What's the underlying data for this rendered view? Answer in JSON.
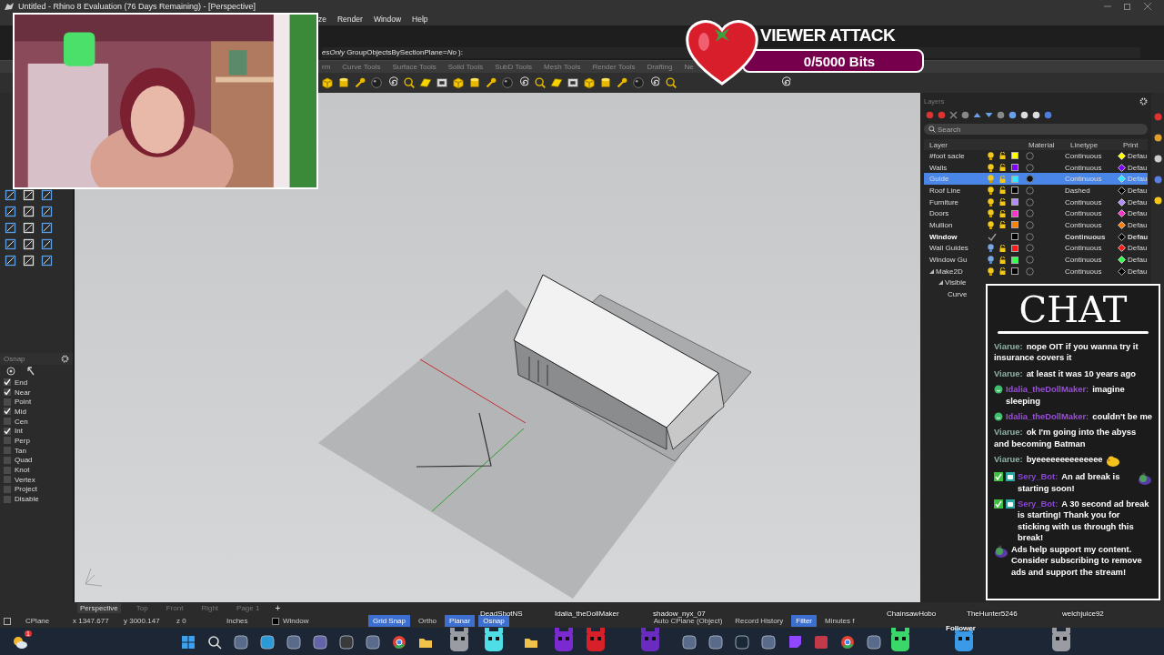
{
  "window": {
    "title": "Untitled - Rhino 8 Evaluation (76 Days Remaining) - [Perspective]"
  },
  "menu": [
    "ze",
    "Render",
    "Window",
    "Help"
  ],
  "command_line": {
    "text": "*esOnly*  GroupObjectsBySectionPlane=*No* ):"
  },
  "toolbar_tabs": [
    "rm",
    "Curve Tools",
    "Surface Tools",
    "Solid Tools",
    "SubD Tools",
    "Mesh Tools",
    "Render Tools",
    "Drafting",
    "Ne"
  ],
  "osnap": {
    "title": "Osnap",
    "items": [
      {
        "label": "End",
        "checked": true
      },
      {
        "label": "Near",
        "checked": true
      },
      {
        "label": "Point",
        "checked": false
      },
      {
        "label": "Mid",
        "checked": true
      },
      {
        "label": "Cen",
        "checked": false
      },
      {
        "label": "Int",
        "checked": true
      },
      {
        "label": "Perp",
        "checked": false
      },
      {
        "label": "Tan",
        "checked": false
      },
      {
        "label": "Quad",
        "checked": false
      },
      {
        "label": "Knot",
        "checked": false
      },
      {
        "label": "Vertex",
        "checked": false
      },
      {
        "label": "Project",
        "checked": false
      },
      {
        "label": "Disable",
        "checked": false
      }
    ]
  },
  "layers": {
    "title": "Layers",
    "search": {
      "placeholder": "Search"
    },
    "columns": [
      "Layer",
      "Material",
      "Linetype",
      "Print"
    ],
    "rows": [
      {
        "name": "#foot sacle",
        "color": "#ffff00",
        "visible": true,
        "material": false,
        "linetype": "Continuous",
        "print": "Defau",
        "current": false,
        "selected": false
      },
      {
        "name": "Walls",
        "color": "#8000ff",
        "visible": true,
        "material": false,
        "linetype": "Continuous",
        "print": "Defau",
        "current": false,
        "selected": false
      },
      {
        "name": "Guide",
        "color": "#33e6ff",
        "visible": true,
        "material": true,
        "linetype": "Continuous",
        "print": "Defau",
        "current": false,
        "selected": true
      },
      {
        "name": "Roof Line",
        "color": "#000000",
        "visible": true,
        "material": false,
        "linetype": "Dashed",
        "print": "Defau",
        "current": false,
        "selected": false
      },
      {
        "name": "Furniture",
        "color": "#b38cff",
        "visible": true,
        "material": false,
        "linetype": "Continuous",
        "print": "Defau",
        "current": false,
        "selected": false
      },
      {
        "name": "Doors",
        "color": "#ff33cc",
        "visible": true,
        "material": false,
        "linetype": "Continuous",
        "print": "Defau",
        "current": false,
        "selected": false
      },
      {
        "name": "Mullion",
        "color": "#ff8000",
        "visible": true,
        "material": false,
        "linetype": "Continuous",
        "print": "Defau",
        "current": false,
        "selected": false
      },
      {
        "name": "Window",
        "color": "#000000",
        "material": false,
        "linetype": "Continuous",
        "print": "Defau",
        "current": true,
        "selected": false
      },
      {
        "name": "Wall Guides",
        "color": "#ff1a1a",
        "visible": false,
        "material": false,
        "linetype": "Continuous",
        "print": "Defau",
        "current": false,
        "selected": false
      },
      {
        "name": "Window Gu",
        "color": "#33ff4d",
        "visible": false,
        "material": false,
        "linetype": "Continuous",
        "print": "Defau",
        "current": false,
        "selected": false
      },
      {
        "name": "Make2D",
        "color": "#000000",
        "visible": true,
        "material": false,
        "linetype": "Continuous",
        "print": "Defau",
        "current": false,
        "selected": false,
        "expanded": true,
        "children": [
          {
            "name": "Visible",
            "expanded": true,
            "children": [
              {
                "name": "Curve"
              }
            ]
          }
        ]
      }
    ]
  },
  "viewport_tabs": [
    {
      "label": "Perspective",
      "selected": true
    },
    {
      "label": "Top",
      "selected": false
    },
    {
      "label": "Front",
      "selected": false
    },
    {
      "label": "Right",
      "selected": false
    },
    {
      "label": "Page 1",
      "selected": false
    }
  ],
  "add_tab": "+",
  "status_bar": {
    "cplane": "CPlane",
    "x": "x 1347.677",
    "y": "y 3000.147",
    "z": "z 0",
    "units": "Inches",
    "layer": "Window",
    "toggles": [
      {
        "label": "Grid Snap",
        "on": true
      },
      {
        "label": "Ortho",
        "on": false
      },
      {
        "label": "Planar",
        "on": true
      },
      {
        "label": "Osnap",
        "on": true
      },
      {
        "label": "Auto CPlane (Object)",
        "on": false
      },
      {
        "label": "Record History",
        "on": false
      },
      {
        "label": "Filter",
        "on": true
      },
      {
        "label": "Minutes f",
        "on": false
      }
    ]
  },
  "taskbar": {
    "weather_badge": "1"
  },
  "overlays": {
    "viewer_attack": {
      "title": "VIEWER ATTACK",
      "progress": "0/5000 Bits"
    },
    "chat": {
      "title": "CHAT",
      "messages": [
        {
          "user": "Viarue:",
          "color": "#8fb3a9",
          "text": "nope OIT if you wanna try it insurance covers it"
        },
        {
          "user": "Viarue:",
          "color": "#8fb3a9",
          "text": "at least it was 10 years ago"
        },
        {
          "user": "Idalia_theDollMaker:",
          "color": "#9a4fd8",
          "badges": [
            {
              "kind": "smiley"
            }
          ],
          "text": "imagine sleeping"
        },
        {
          "user": "Idalia_theDollMaker:",
          "color": "#9a4fd8",
          "badges": [
            {
              "kind": "smiley"
            }
          ],
          "text": "couldn't be me"
        },
        {
          "user": "Viarue:",
          "color": "#8fb3a9",
          "text": "ok I'm going into the abyss and becoming Batman"
        },
        {
          "user": "Viarue:",
          "color": "#8fb3a9",
          "text": "byeeeeeeeeeeeeee",
          "emote": {
            "kind": "duck"
          }
        },
        {
          "user": "Sery_Bot:",
          "color": "#8a45d6",
          "badges": [
            {
              "kind": "check"
            },
            {
              "kind": "robot"
            }
          ],
          "text": "An ad break is starting soon!",
          "emote": {
            "kind": "gremlin"
          }
        },
        {
          "user": "Sery_Bot:",
          "color": "#8a45d6",
          "badges": [
            {
              "kind": "check"
            },
            {
              "kind": "robot"
            }
          ],
          "text": "A 30 second ad break is starting! Thank you for sticking with us through this break!",
          "emote": {
            "kind": "gremlin"
          },
          "text_after": "Ads help support my content. Consider subscribing to remove ads and support the stream!"
        }
      ]
    },
    "pets": [
      {
        "color": "#9a9ca3"
      },
      {
        "name": "DeadShotNS",
        "color": "#4fdde6"
      },
      {
        "name": "Idalia_theDollMaker",
        "color": "#7a2ad0"
      },
      {
        "color": "#d8202a"
      },
      {
        "name": "shadow_nyx_07",
        "color": "#6a2cc0"
      },
      {
        "name": "ChainsawHobo",
        "color": "#3ad86a"
      },
      {
        "name": "TheHunter5246",
        "color": "#3a9ae8"
      },
      {
        "name": "welchjuice92",
        "color": "#9a9ca3"
      }
    ],
    "follower_label": "Follower"
  }
}
